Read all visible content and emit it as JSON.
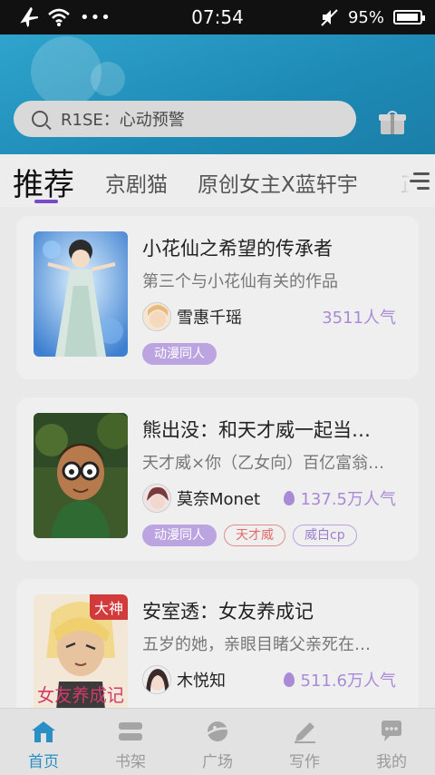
{
  "status_bar": {
    "time": "07:54",
    "battery": "95%",
    "battery_level": 0.95,
    "icons": [
      "airplane-icon",
      "wifi-icon",
      "more-dots-icon",
      "mute-icon",
      "battery-icon"
    ]
  },
  "search": {
    "placeholder": "R1SE：心动预警"
  },
  "tabs": [
    {
      "label": "推荐",
      "active": true
    },
    {
      "label": "京剧猫"
    },
    {
      "label": "原创女主X蓝轩宇"
    },
    {
      "label": "正"
    }
  ],
  "cards": [
    {
      "title": "小花仙之希望的传承者",
      "desc": "第三个与小花仙有关的作品",
      "author": "雪惠千瑶",
      "popularity": "3511人气",
      "tags": [
        "动漫同人"
      ]
    },
    {
      "title": "熊出没：和天才威一起当…",
      "desc": "天才威×你（乙女向）百亿富翁…",
      "author": "莫奈Monet",
      "popularity": "137.5万人气",
      "tags": [
        "动漫同人",
        "天才威",
        "威白cp"
      ]
    },
    {
      "title": "安室透：女友养成记",
      "desc": "五岁的她，亲眼目睹父亲死在…",
      "author": "木悦知",
      "popularity": "511.6万人气",
      "badge": "大神",
      "cover_text": "女友养成记",
      "tags": []
    }
  ],
  "bottom_nav": [
    {
      "label": "首页",
      "icon": "home-icon",
      "active": true
    },
    {
      "label": "书架",
      "icon": "bookshelf-icon"
    },
    {
      "label": "广场",
      "icon": "planet-icon"
    },
    {
      "label": "写作",
      "icon": "pen-icon"
    },
    {
      "label": "我的",
      "icon": "chat-bubble-icon"
    }
  ],
  "colors": {
    "accent": "#7a4bc9",
    "header": "#1f8fbb",
    "nav_active": "#2a8fc4",
    "popularity": "#a98ad7"
  }
}
